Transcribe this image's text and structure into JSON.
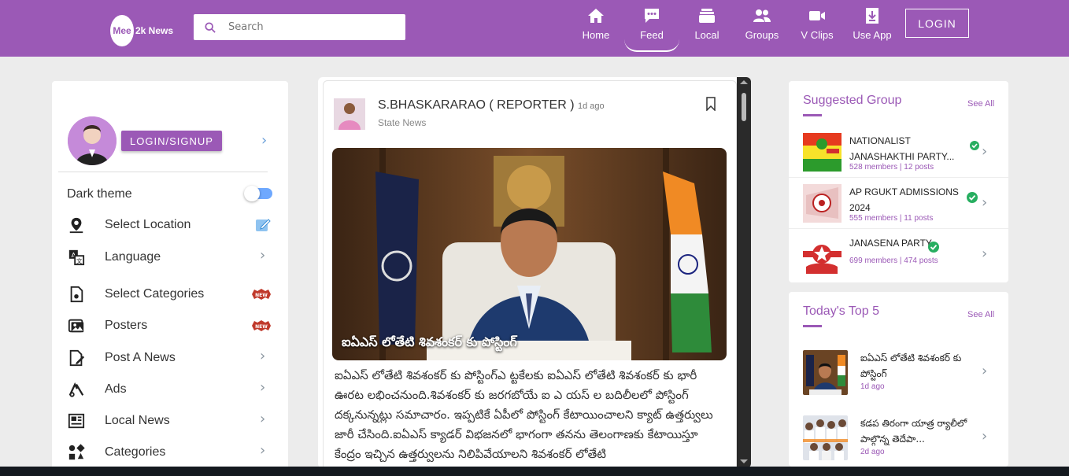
{
  "brand": {
    "logo_main": "Mee",
    "logo_sub": "2k News"
  },
  "search": {
    "placeholder": "Search"
  },
  "nav": [
    {
      "label": "Home",
      "icon": "home-icon"
    },
    {
      "label": "Feed",
      "icon": "chat-icon",
      "active": true
    },
    {
      "label": "Local",
      "icon": "stack-icon"
    },
    {
      "label": "Groups",
      "icon": "groups-icon"
    },
    {
      "label": "V Clips",
      "icon": "video-icon"
    },
    {
      "label": "Use App",
      "icon": "download-icon"
    }
  ],
  "login_label": "LOGIN",
  "sidebar": {
    "signup_label": "LOGIN/SIGNUP",
    "dark_theme_label": "Dark theme",
    "items": [
      {
        "label": "Select Location",
        "icon": "location-pin-icon",
        "right": "edit-icon"
      },
      {
        "label": "Language",
        "icon": "language-icon",
        "right": "chevron"
      },
      {
        "label": "Select Categories",
        "icon": "categories-file-icon",
        "right": "new-badge"
      },
      {
        "label": "Posters",
        "icon": "posters-icon",
        "right": "new-badge"
      },
      {
        "label": "Post A News",
        "icon": "post-news-icon",
        "right": "chevron"
      },
      {
        "label": "Ads",
        "icon": "ads-icon",
        "right": "chevron"
      },
      {
        "label": "Local News",
        "icon": "local-news-icon",
        "right": "chevron"
      },
      {
        "label": "Categories",
        "icon": "grid-shapes-icon",
        "right": "chevron"
      }
    ],
    "new_badge_text": "NEW"
  },
  "post": {
    "author": "S.BHASKARARAO ( REPORTER )",
    "time": "1d ago",
    "category": "State News",
    "caption": "ఐఏఎస్ లోతేటి శివశంకర్ కు పోస్టింగ్",
    "body": "ఐఏఎస్ లోతేటి శివశంకర్ కు పోస్టింగ్ఎ ట్టకేలకు ఐఏఎస్ లోతేటి శివశంకర్ కు భారీ ఊరట లభించనుంది.శివశంకర్ కు జరగబోయే ఐ ఎ యస్ ల బదిలీలలో పోస్టింగ్ దక్కనున్నట్లు సమాచారం. ఇప్పటికే ఏపీలో పోస్టింగ్ కేటాయించాలని క్యాట్ ఉత్తర్వులు జారీ చేసింది.ఐఏఎస్ క్యాడర్ విభజనలో భాగంగా తనను తెలంగాణకు కేటాయిస్తూ కేంద్రం ఇచ్చిన ఉత్తర్వులను నిలిపివేయాలని శివశంకర్ లోతేటి"
  },
  "suggested": {
    "title": "Suggested Group",
    "see_all": "See All",
    "groups": [
      {
        "name": "NATIONALIST JANASHAKTHI PARTY...",
        "meta": "528 members | 12 posts"
      },
      {
        "name": "AP RGUKT ADMISSIONS 2024",
        "meta": "555 members | 11 posts"
      },
      {
        "name": "JANASENA PARTY",
        "meta": "699 members | 474 posts"
      }
    ]
  },
  "top5": {
    "title": "Today's Top 5",
    "see_all": "See All",
    "items": [
      {
        "title": "ఐఏఎస్ లోతేటి శివశంకర్ కు పోస్టింగ్",
        "time": "1d ago"
      },
      {
        "title": "కడప తిరంగా యాత్ర ర్యాలీలో పాల్గొన్న తెదేపా...",
        "time": "2d ago"
      }
    ]
  },
  "colors": {
    "brand": "#9b59b6",
    "verified": "#27ae60",
    "badge": "#c0392b"
  }
}
